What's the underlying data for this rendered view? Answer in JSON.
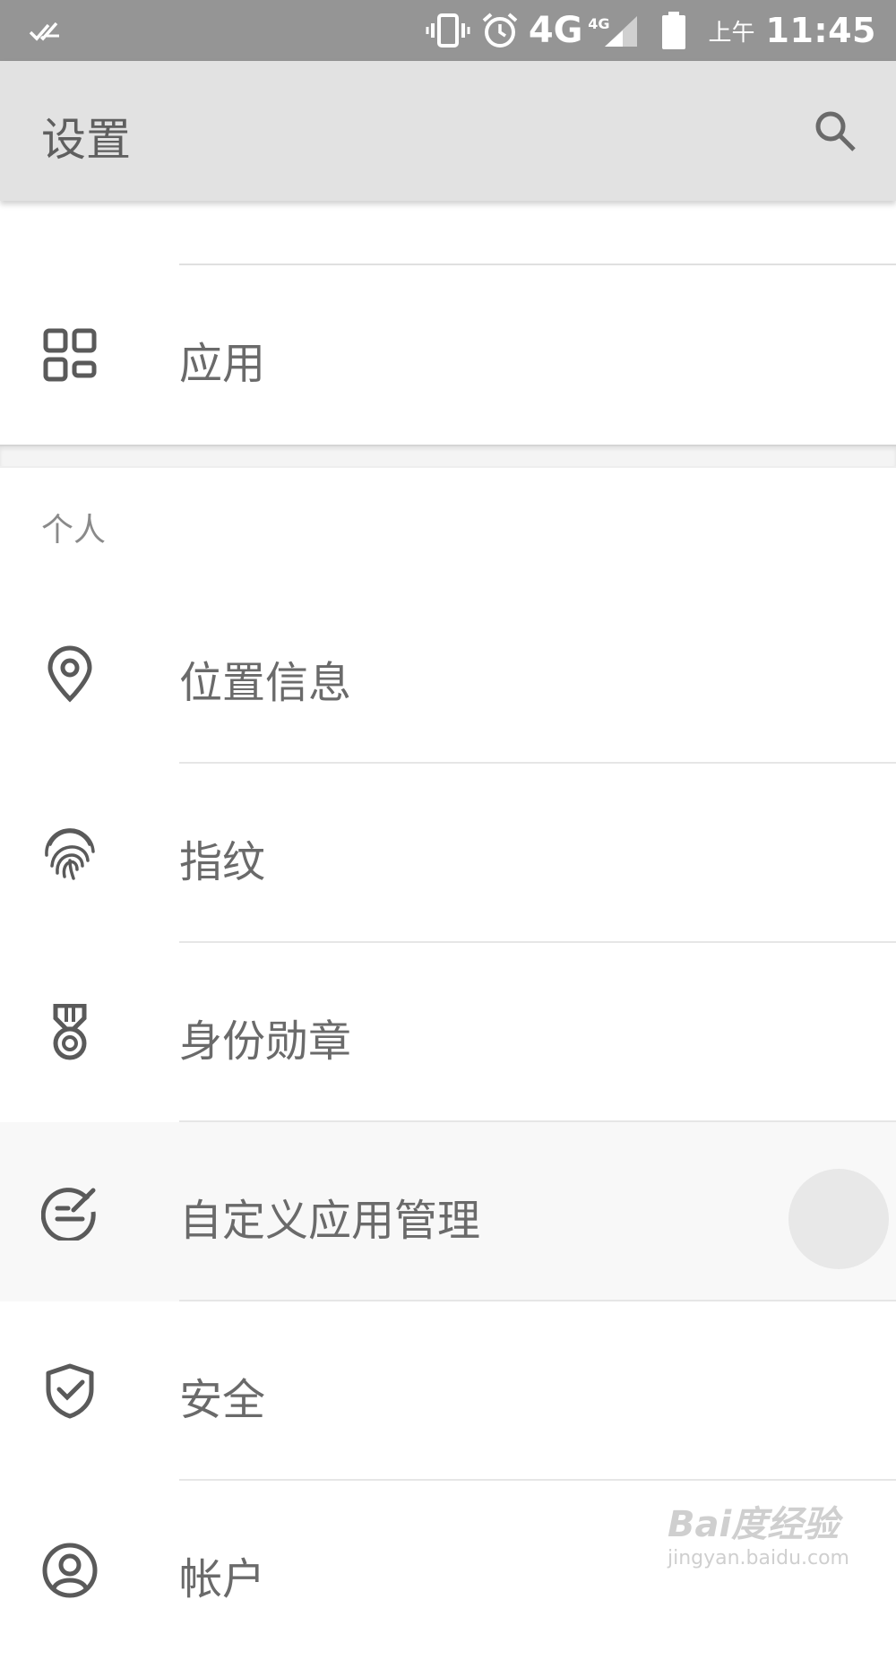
{
  "status_bar": {
    "network": "4G",
    "network_sup": "4G",
    "ampm": "上午",
    "time": "11:45",
    "icons": [
      "done-all-icon",
      "vibrate-icon",
      "alarm-icon",
      "signal-icon",
      "battery-icon"
    ]
  },
  "app_bar": {
    "title": "设置",
    "search_icon": "search-icon"
  },
  "rows": [
    {
      "label": "应用",
      "icon": "apps-grid-icon"
    },
    {
      "label": "位置信息",
      "icon": "location-pin-icon"
    },
    {
      "label": "指纹",
      "icon": "fingerprint-icon"
    },
    {
      "label": "身份勋章",
      "icon": "medal-icon"
    },
    {
      "label": "自定义应用管理",
      "icon": "custom-app-manage-icon"
    },
    {
      "label": "安全",
      "icon": "shield-check-icon"
    },
    {
      "label": "帐户",
      "icon": "account-icon"
    }
  ],
  "section_personal": "个人",
  "watermark": {
    "line1": "Bai度经验",
    "line2": "jingyan.baidu.com"
  },
  "colors": {
    "status_bar": "#959595",
    "app_bar": "#e2e2e2",
    "icon": "#5a5a5a",
    "text": "#6a6a6a"
  }
}
